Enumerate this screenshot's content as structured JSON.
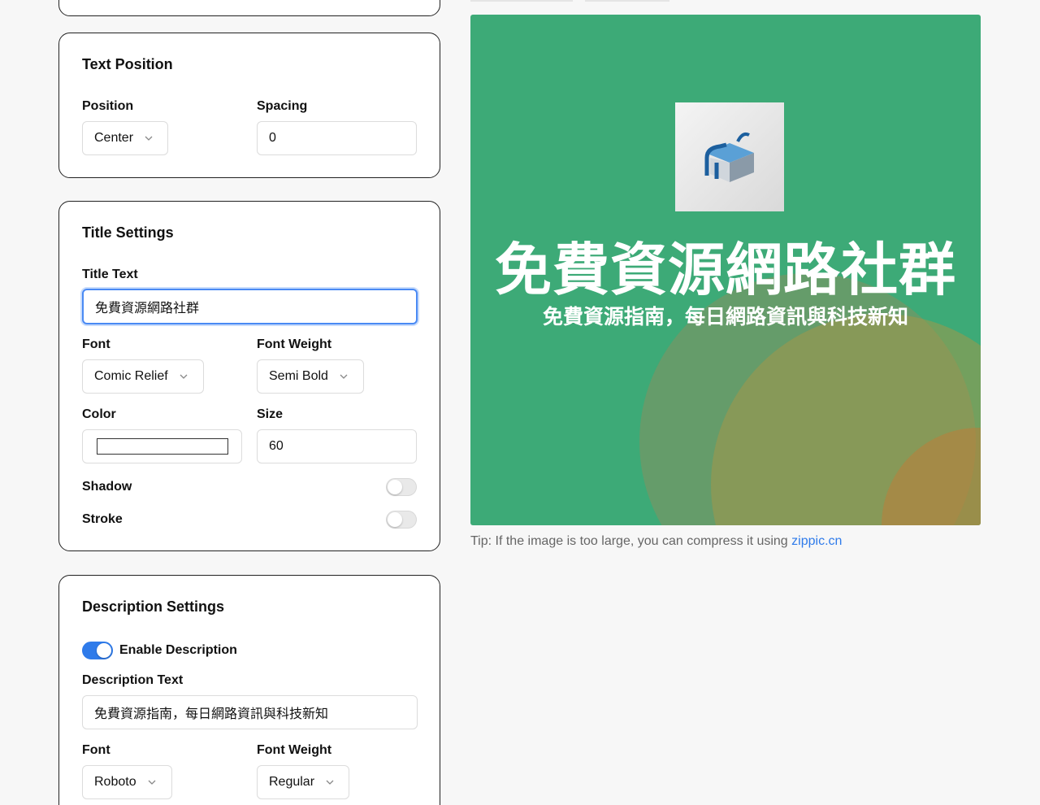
{
  "text_position": {
    "title": "Text Position",
    "position_label": "Position",
    "position_value": "Center",
    "spacing_label": "Spacing",
    "spacing_value": "0"
  },
  "title_settings": {
    "title": "Title Settings",
    "title_text_label": "Title Text",
    "title_text_value": "免費資源網路社群",
    "font_label": "Font",
    "font_value": "Comic Relief",
    "weight_label": "Font Weight",
    "weight_value": "Semi Bold",
    "color_label": "Color",
    "color_value": "#ffffff",
    "size_label": "Size",
    "size_value": "60",
    "shadow_label": "Shadow",
    "stroke_label": "Stroke"
  },
  "description_settings": {
    "title": "Description Settings",
    "enable_label": "Enable Description",
    "text_label": "Description Text",
    "text_value": "免費資源指南，每日網路資訊與科技新知",
    "font_label": "Font",
    "font_value": "Roboto",
    "weight_label": "Font Weight",
    "weight_value": "Regular"
  },
  "preview": {
    "background_color": "#3daa77",
    "title": "免費資源網路社群",
    "description": "免費資源指南，每日網路資訊與科技新知"
  },
  "tip": {
    "text": "Tip: If the image is too large, you can compress it using ",
    "link": "zippic.cn"
  },
  "colors": {
    "accent": "#2f7bea",
    "preview_bg": "#3daa77"
  }
}
